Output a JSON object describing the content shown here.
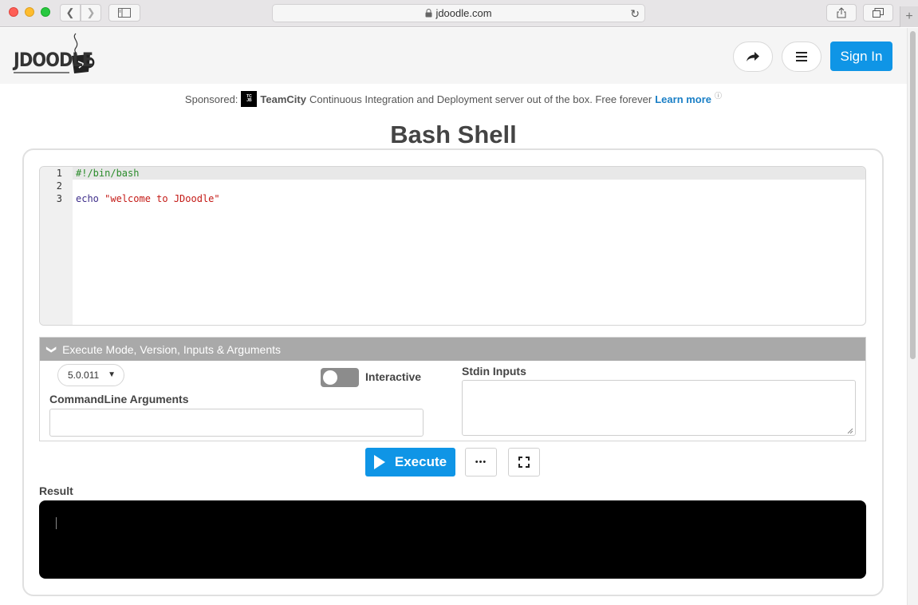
{
  "browser": {
    "url": "jdoodle.com"
  },
  "header": {
    "logo_text": "JDOODLE",
    "signin_label": "Sign In"
  },
  "sponsor": {
    "prefix": "Sponsored:",
    "brand": "TeamCity",
    "text": "Continuous Integration and Deployment server out of the box. Free forever",
    "link": "Learn more",
    "info": "i"
  },
  "page": {
    "title": "Bash Shell"
  },
  "editor": {
    "lines": [
      {
        "num": "1",
        "code": "#!/bin/bash"
      },
      {
        "num": "2",
        "code": ""
      },
      {
        "num": "3",
        "keyword": "echo",
        "string": "\"welcome to JDoodle\""
      }
    ]
  },
  "exec_panel": {
    "header": "Execute Mode, Version, Inputs & Arguments",
    "version": "5.0.011",
    "interactive_label": "Interactive",
    "interactive_on": false,
    "args_label": "CommandLine Arguments",
    "args_value": "",
    "stdin_label": "Stdin Inputs",
    "stdin_value": ""
  },
  "actions": {
    "execute_label": "Execute",
    "more_label": "•••"
  },
  "result": {
    "label": "Result",
    "output": ""
  }
}
